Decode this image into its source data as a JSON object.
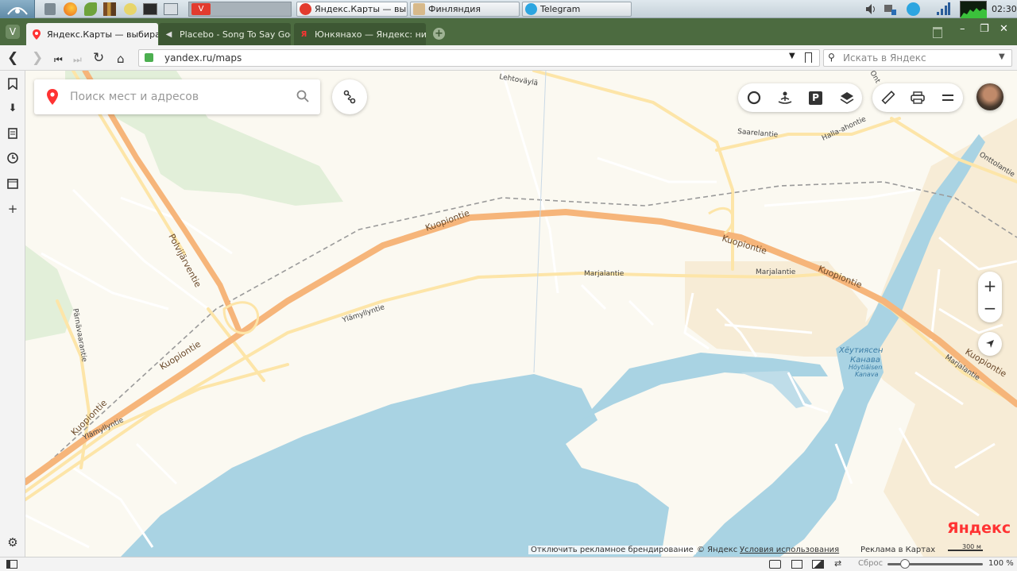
{
  "taskbar": {
    "windows": [
      {
        "label": "Яндекс.Карты — вы...",
        "icon": "vivaldi-icon"
      },
      {
        "label": "Финляндия",
        "icon": "folder-icon"
      },
      {
        "label": "Telegram",
        "icon": "telegram-icon"
      }
    ],
    "clock": "02:30"
  },
  "tabs": [
    {
      "label": "Яндекс.Карты — выбирайт",
      "icon": "map-pin-icon",
      "active": true
    },
    {
      "label": "Placebo - Song To Say Good",
      "icon": "speaker-icon",
      "active": false
    },
    {
      "label": "Юнкянахо — Яндекс: ниче",
      "icon": "yandex-icon",
      "active": false
    }
  ],
  "address": {
    "url": "yandex.ru/maps",
    "search_placeholder": "Искать в Яндекс"
  },
  "map": {
    "search_placeholder": "Поиск мест и адресов",
    "labels": {
      "kuopiontie": "Kuopiontie",
      "polvijarventie": "Polvijärventie",
      "marjalantie": "Marjalantie",
      "ylamyllyntie": "Ylämyllyntie",
      "saarelantie": "Saarelantie",
      "halla_ahontie": "Halla-ahontie",
      "onttolantie": "Onttolantie",
      "parnavaarantie": "Pärnävaarantie",
      "lehtovayla": "Lehtoväylä",
      "ont": "Ont",
      "canal_ru_1": "Хёутиясен",
      "canal_ru_2": "Канава",
      "canal_fi_1": "Höytiäisen",
      "canal_fi_2": "Kanava"
    },
    "logo": "Яндекс",
    "footer": {
      "disable_branding": "Отключить рекламное брендирование",
      "copyright": "© Яндекс",
      "terms": "Условия использования",
      "ads": "Реклама в Картах",
      "scale": "300 м"
    }
  },
  "statusbar": {
    "reset": "Сброс",
    "zoom": "100 %"
  },
  "colors": {
    "water": "#a9d3e3",
    "major_road": "#f6b57a",
    "minor_road": "#fde5a8",
    "forest": "#e2efd9",
    "residential": "#f7ecd6",
    "browser_green": "#4c6b40"
  }
}
